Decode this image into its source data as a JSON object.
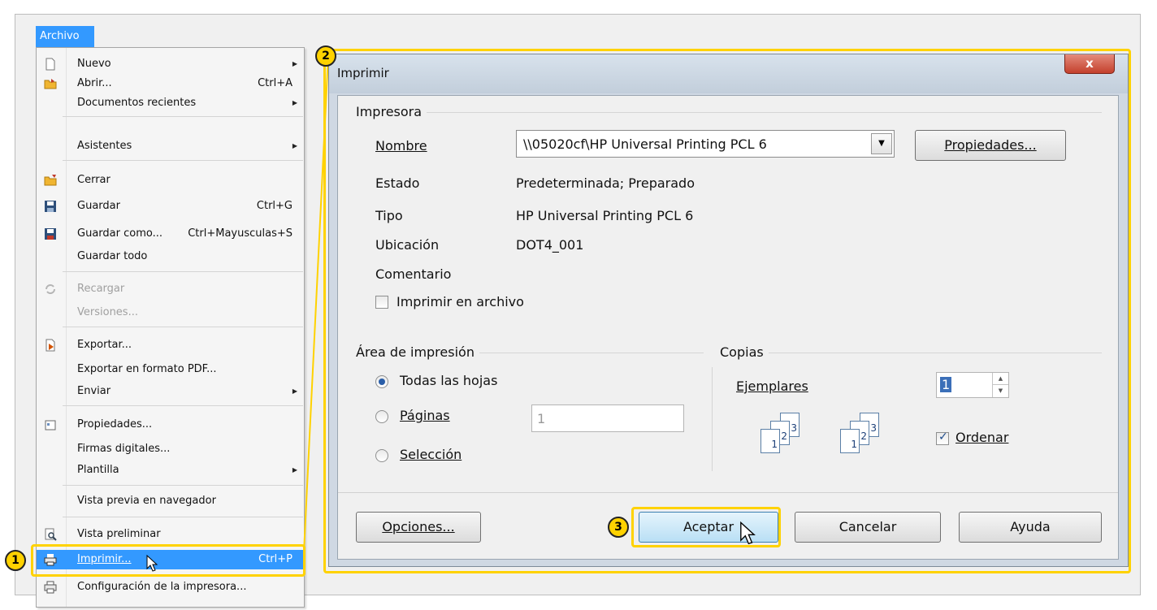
{
  "menu": {
    "title": "Archivo",
    "items": [
      {
        "label": "Nuevo",
        "shortcut": "",
        "submenu": true
      },
      {
        "label": "Abrir...",
        "shortcut": "Ctrl+A",
        "submenu": false
      },
      {
        "label": "Documentos recientes",
        "shortcut": "",
        "submenu": true
      },
      {
        "label": "Asistentes",
        "shortcut": "",
        "submenu": true
      },
      {
        "label": "Cerrar",
        "shortcut": "",
        "submenu": false
      },
      {
        "label": "Guardar",
        "shortcut": "Ctrl+G",
        "submenu": false
      },
      {
        "label": "Guardar como...",
        "shortcut": "Ctrl+Mayusculas+S",
        "submenu": false
      },
      {
        "label": "Guardar todo",
        "shortcut": "",
        "submenu": false
      },
      {
        "label": "Recargar",
        "shortcut": "",
        "submenu": false
      },
      {
        "label": "Versiones...",
        "shortcut": "",
        "submenu": false
      },
      {
        "label": "Exportar...",
        "shortcut": "",
        "submenu": false
      },
      {
        "label": "Exportar en formato PDF...",
        "shortcut": "",
        "submenu": false
      },
      {
        "label": "Enviar",
        "shortcut": "",
        "submenu": true
      },
      {
        "label": "Propiedades...",
        "shortcut": "",
        "submenu": false
      },
      {
        "label": "Firmas digitales...",
        "shortcut": "",
        "submenu": false
      },
      {
        "label": "Plantilla",
        "shortcut": "",
        "submenu": true
      },
      {
        "label": "Vista previa en navegador",
        "shortcut": "",
        "submenu": false
      },
      {
        "label": "Vista preliminar",
        "shortcut": "",
        "submenu": false
      },
      {
        "label": "Imprimir...",
        "shortcut": "Ctrl+P",
        "submenu": false
      },
      {
        "label": "Configuración de la impresora...",
        "shortcut": "",
        "submenu": false
      }
    ]
  },
  "badges": {
    "one": "1",
    "two": "2",
    "three": "3"
  },
  "dialog": {
    "title": "Imprimir",
    "close": "x",
    "printer_group": "Impresora",
    "name_label": "Nombre",
    "printer_name": "\\\\05020cf\\HP Universal Printing PCL 6",
    "properties_button": "Propiedades...",
    "status_label": "Estado",
    "status_value": "Predeterminada; Preparado",
    "type_label": "Tipo",
    "type_value": "HP Universal Printing PCL 6",
    "location_label": "Ubicación",
    "location_value": "DOT4_001",
    "comment_label": "Comentario",
    "print_to_file": "Imprimir en archivo",
    "print_area_group": "Área de impresión",
    "all_sheets": "Todas las hojas",
    "pages": "Páginas",
    "pages_value": "1",
    "selection": "Selección",
    "copies_group": "Copias",
    "copies_label": "Ejemplares",
    "copies_value": "1",
    "collate": "Ordenar",
    "options_button": "Opciones...",
    "ok_button": "Aceptar",
    "cancel_button": "Cancelar",
    "help_button": "Ayuda"
  },
  "colors": {
    "highlight": "#ffd200",
    "menu_selection": "#3399ff"
  }
}
